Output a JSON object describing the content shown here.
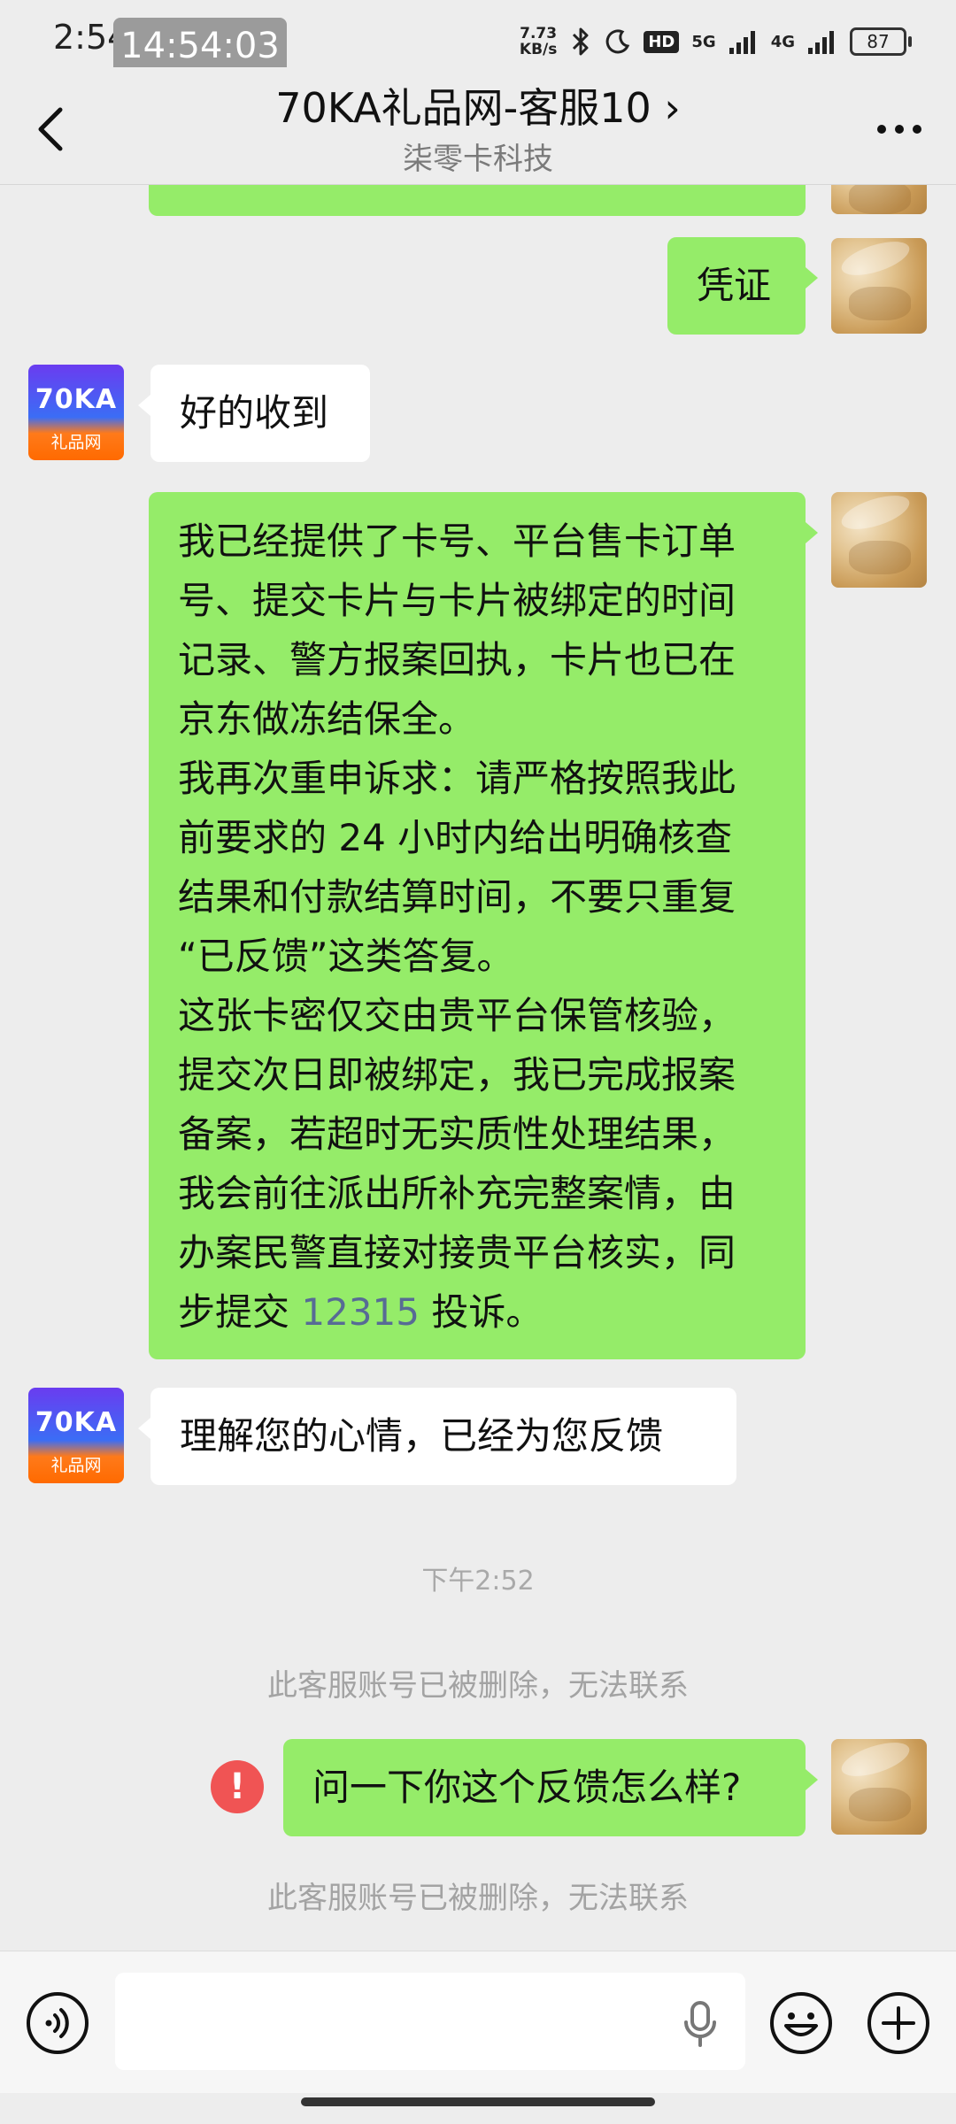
{
  "status_bar": {
    "time": "2:54",
    "clock_overlay": "14:54:03",
    "net_speed": "7.73",
    "net_speed_unit": "KB/s",
    "hd": "HD",
    "net_5g": "5G",
    "net_4g": "4G",
    "battery": "87"
  },
  "header": {
    "title": "70KA礼品网-客服10 ›",
    "subtitle": "柒零卡科技"
  },
  "contact_avatar": {
    "logo_text": "70KA",
    "logo_sub": "礼品网"
  },
  "messages": {
    "m1_text": "凭证",
    "m2_text": "好的收到",
    "m3_lines": [
      "我已经提供了卡号、平台售卡订单",
      "号、提交卡片与卡片被绑定的时间",
      "记录、警方报案回执，卡片也已在",
      "京东做冻结保全。",
      "我再次重申诉求：请严格按照我此",
      "前要求的 24 小时内给出明确核查",
      "结果和付款结算时间，不要只重复",
      "“已反馈”这类答复。",
      "这张卡密仅交由贵平台保管核验，",
      "提交次日即被绑定，我已完成报案",
      "备案，若超时无实质性处理结果，",
      "我会前往派出所补充完整案情，由",
      "办案民警直接对接贵平台核实，同"
    ],
    "m3_last_prefix": "步提交 ",
    "m3_last_link": "12315",
    "m3_last_suffix": " 投诉。",
    "m4_text": "理解您的心情，已经为您反馈",
    "time_divider": "下午2:52",
    "notice_1": "此客服账号已被删除，无法联系",
    "m5_text": "问一下你这个反馈怎么样?",
    "m5_error": "!",
    "notice_2": "此客服账号已被删除，无法联系"
  },
  "input_bar": {
    "placeholder": ""
  },
  "icons": {
    "back": "chevron-left-icon",
    "more": "more-dots-icon",
    "voice": "voice-mode-icon",
    "mic": "microphone-icon",
    "emoji": "emoji-icon",
    "plus": "plus-icon",
    "error": "send-failed-icon"
  },
  "colors": {
    "my_bubble": "#95ec69",
    "their_bubble": "#ffffff",
    "background": "#ededed",
    "error": "#f05454",
    "link": "#576b95"
  }
}
